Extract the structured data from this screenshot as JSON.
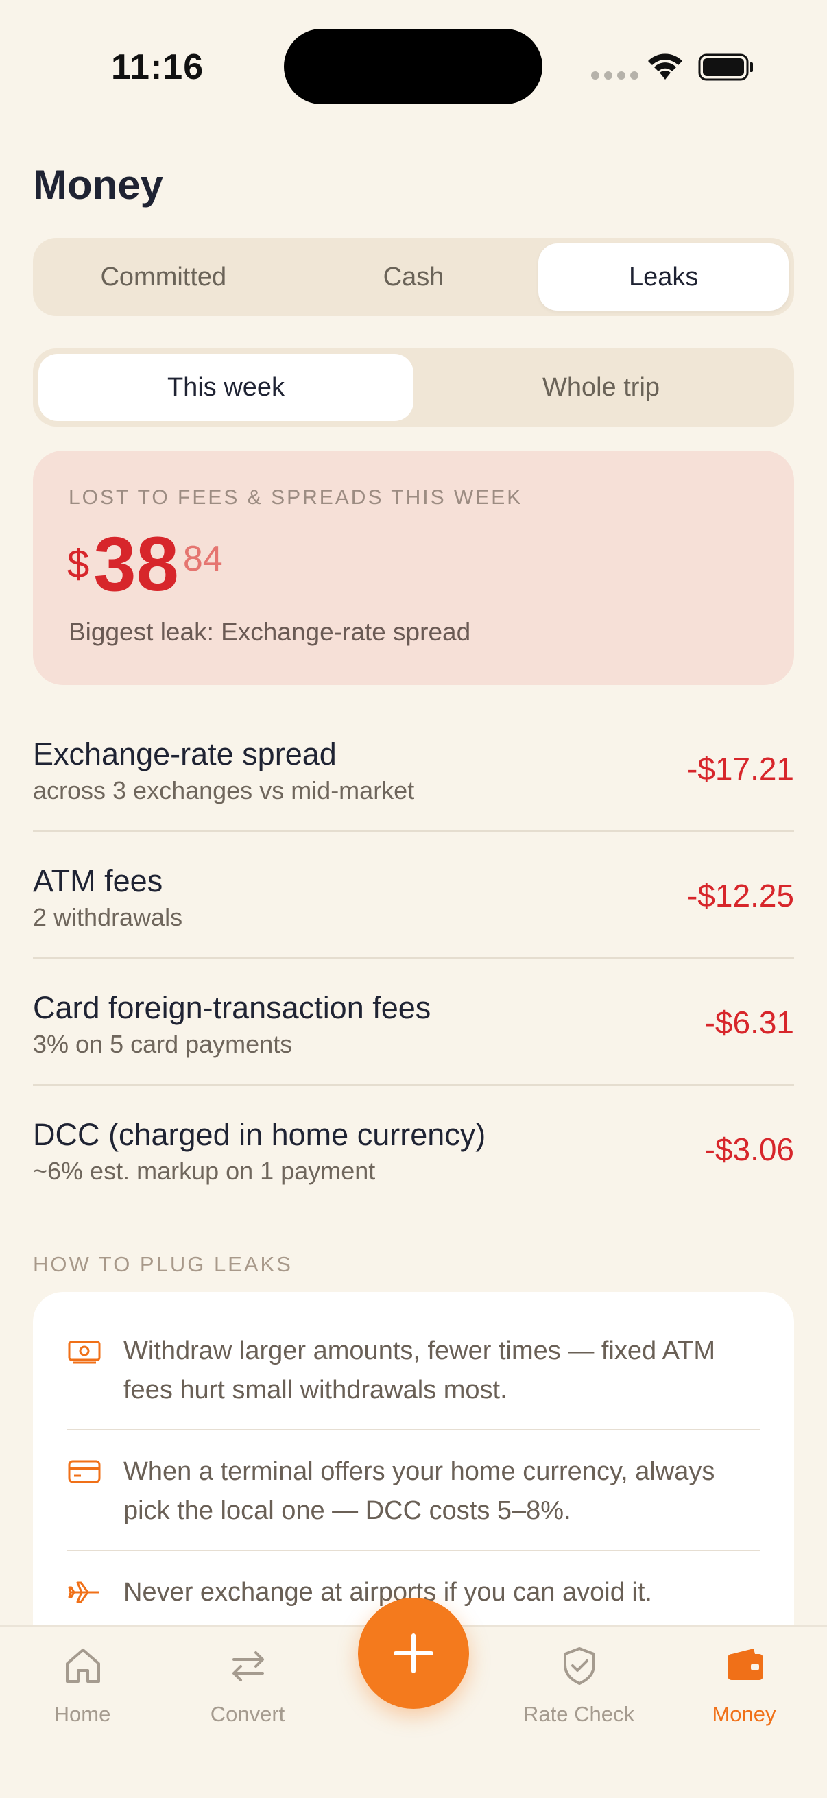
{
  "status_bar": {
    "time": "11:16"
  },
  "title": "Money",
  "segments": [
    {
      "label": "Committed",
      "active": false
    },
    {
      "label": "Cash",
      "active": false
    },
    {
      "label": "Leaks",
      "active": true
    }
  ],
  "periods": [
    {
      "label": "This week",
      "active": true
    },
    {
      "label": "Whole trip",
      "active": false
    }
  ],
  "summary": {
    "label": "LOST TO FEES & SPREADS THIS WEEK",
    "currency": "$",
    "amount_int": "38",
    "amount_cents": "84",
    "biggest": "Biggest leak: Exchange-rate spread"
  },
  "leaks": [
    {
      "name": "Exchange-rate spread",
      "sub": "across 3 exchanges vs mid-market",
      "amount": "-$17.21"
    },
    {
      "name": "ATM fees",
      "sub": "2 withdrawals",
      "amount": "-$12.25"
    },
    {
      "name": "Card foreign-transaction fees",
      "sub": "3% on 5 card payments",
      "amount": "-$6.31"
    },
    {
      "name": "DCC (charged in home currency)",
      "sub": "~6% est. markup on 1 payment",
      "amount": "-$3.06"
    }
  ],
  "tips_heading": "HOW TO PLUG LEAKS",
  "tips": [
    {
      "icon": "cash-icon",
      "text": "Withdraw larger amounts, fewer times — fixed ATM fees hurt small withdrawals most."
    },
    {
      "icon": "credit-card-icon",
      "text": "When a terminal offers your home currency, always pick the local one — DCC costs 5–8%."
    },
    {
      "icon": "airplane-icon",
      "text": "Never exchange at airports if you can avoid it."
    }
  ],
  "tabs": [
    {
      "label": "Home",
      "icon": "home-icon",
      "active": false
    },
    {
      "label": "Convert",
      "icon": "swap-arrows-icon",
      "active": false
    },
    {
      "label": "Rate Check",
      "icon": "shield-check-icon",
      "active": false
    },
    {
      "label": "Money",
      "icon": "wallet-icon",
      "active": true
    }
  ],
  "colors": {
    "accent": "#f47a1d",
    "loss": "#d7262b",
    "background": "#f9f4ea"
  }
}
